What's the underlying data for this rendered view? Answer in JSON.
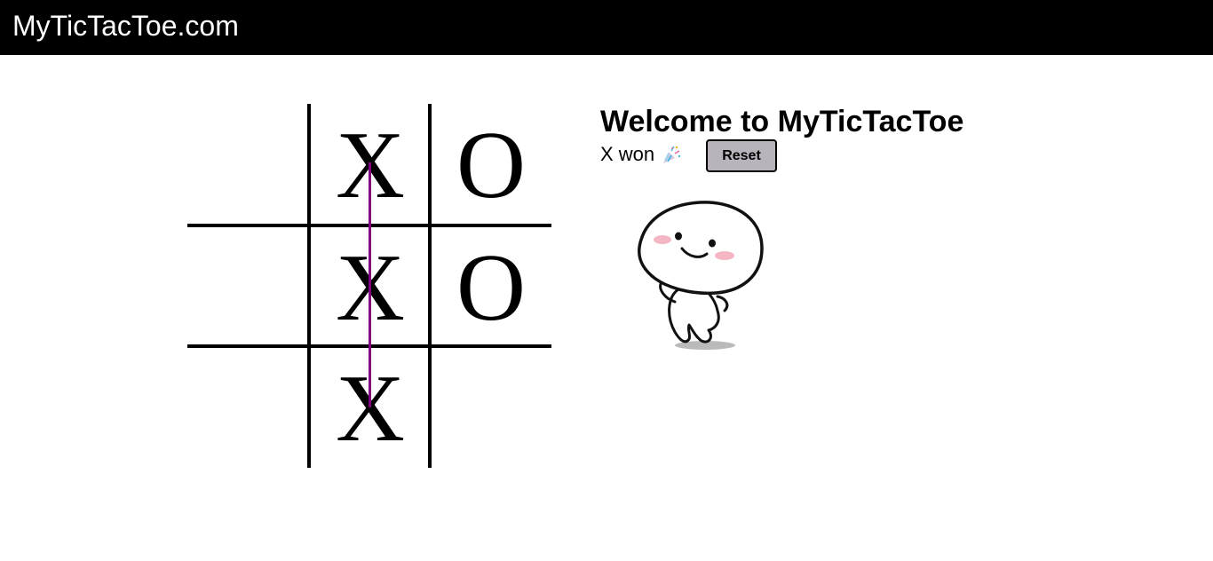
{
  "header": {
    "brand": "MyTicTacToe.com"
  },
  "board": {
    "cells": [
      "",
      "X",
      "O",
      "",
      "X",
      "O",
      "",
      "X",
      ""
    ],
    "win_line_color": "#800080",
    "winning_cells": [
      1,
      4,
      7
    ]
  },
  "panel": {
    "title": "Welcome to MyTicTacToe",
    "status": "X won",
    "status_icon": "party-popper-icon",
    "reset_label": "Reset"
  },
  "mascot": {
    "icon": "cute-mascot-character-illustration"
  },
  "colors": {
    "header_bg": "#000000",
    "reset_bg": "#b9b3bb",
    "win_line": "#800080"
  }
}
